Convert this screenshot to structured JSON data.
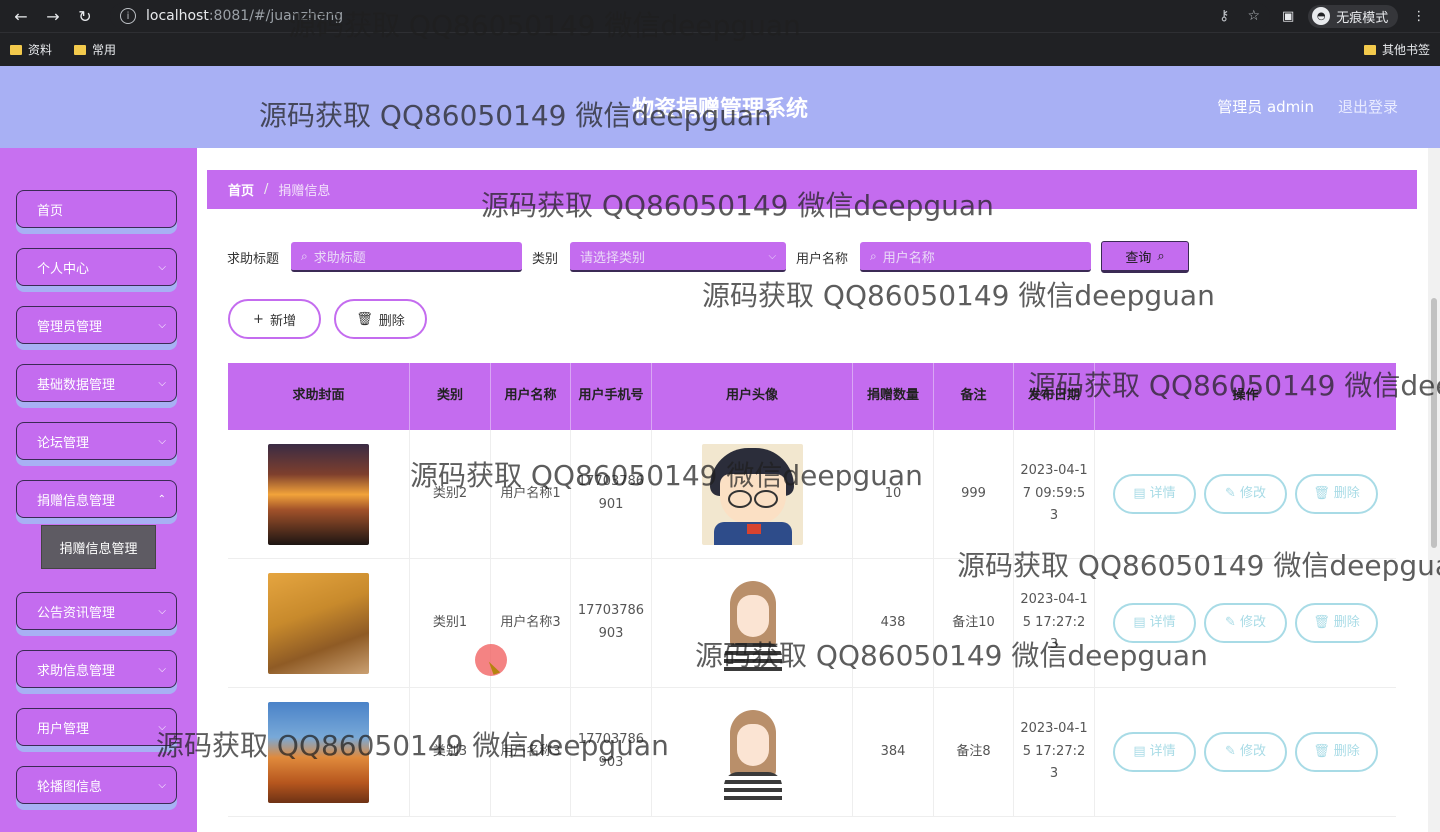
{
  "browser": {
    "url_host": "localhost",
    "url_rest": ":8081/#/juanzheng",
    "incognito_label": "无痕模式",
    "bookmarks": [
      "资料",
      "常用"
    ],
    "other_bookmarks": "其他书签"
  },
  "header": {
    "title": "物资捐赠管理系统",
    "admin_label": "管理员 admin",
    "logout_label": "退出登录"
  },
  "sidebar": {
    "items": [
      {
        "label": "首页"
      },
      {
        "label": "个人中心"
      },
      {
        "label": "管理员管理"
      },
      {
        "label": "基础数据管理"
      },
      {
        "label": "论坛管理"
      },
      {
        "label": "捐赠信息管理"
      },
      {
        "label": "公告资讯管理"
      },
      {
        "label": "求助信息管理"
      },
      {
        "label": "用户管理"
      },
      {
        "label": "轮播图信息"
      }
    ],
    "submenu_label": "捐赠信息管理"
  },
  "breadcrumb": {
    "home": "首页",
    "separator": "/",
    "current": "捐赠信息"
  },
  "search": {
    "title_label": "求助标题",
    "title_placeholder": "求助标题",
    "category_label": "类别",
    "category_placeholder": "请选择类别",
    "username_label": "用户名称",
    "username_placeholder": "用户名称",
    "query_button": "查询"
  },
  "actions": {
    "add_label": "新增",
    "delete_label": "删除"
  },
  "table": {
    "headers": [
      "求助封面",
      "类别",
      "用户名称",
      "用户手机号",
      "用户头像",
      "捐赠数量",
      "备注",
      "发布日期",
      "操作"
    ],
    "rows": [
      {
        "category": "类别2",
        "username": "用户名称1",
        "phone": "17703786901",
        "quantity": "10",
        "remark": "999",
        "date": "2023-04-17 09:59:53"
      },
      {
        "category": "类别1",
        "username": "用户名称3",
        "phone": "17703786903",
        "quantity": "438",
        "remark": "备注10",
        "date": "2023-04-15 17:27:23"
      },
      {
        "category": "类别3",
        "username": "用户名称3",
        "phone": "17703786903",
        "quantity": "384",
        "remark": "备注8",
        "date": "2023-04-15 17:27:23"
      }
    ],
    "op_detail": "详情",
    "op_edit": "修改",
    "op_delete": "删除"
  },
  "watermark": "源码获取 QQ86050149 微信deepguan",
  "colors": {
    "header_bg": "#a8b0f4",
    "sidebar_bg": "#c770f0",
    "accent": "#c46cef",
    "op_border": "#a8dbe6"
  }
}
